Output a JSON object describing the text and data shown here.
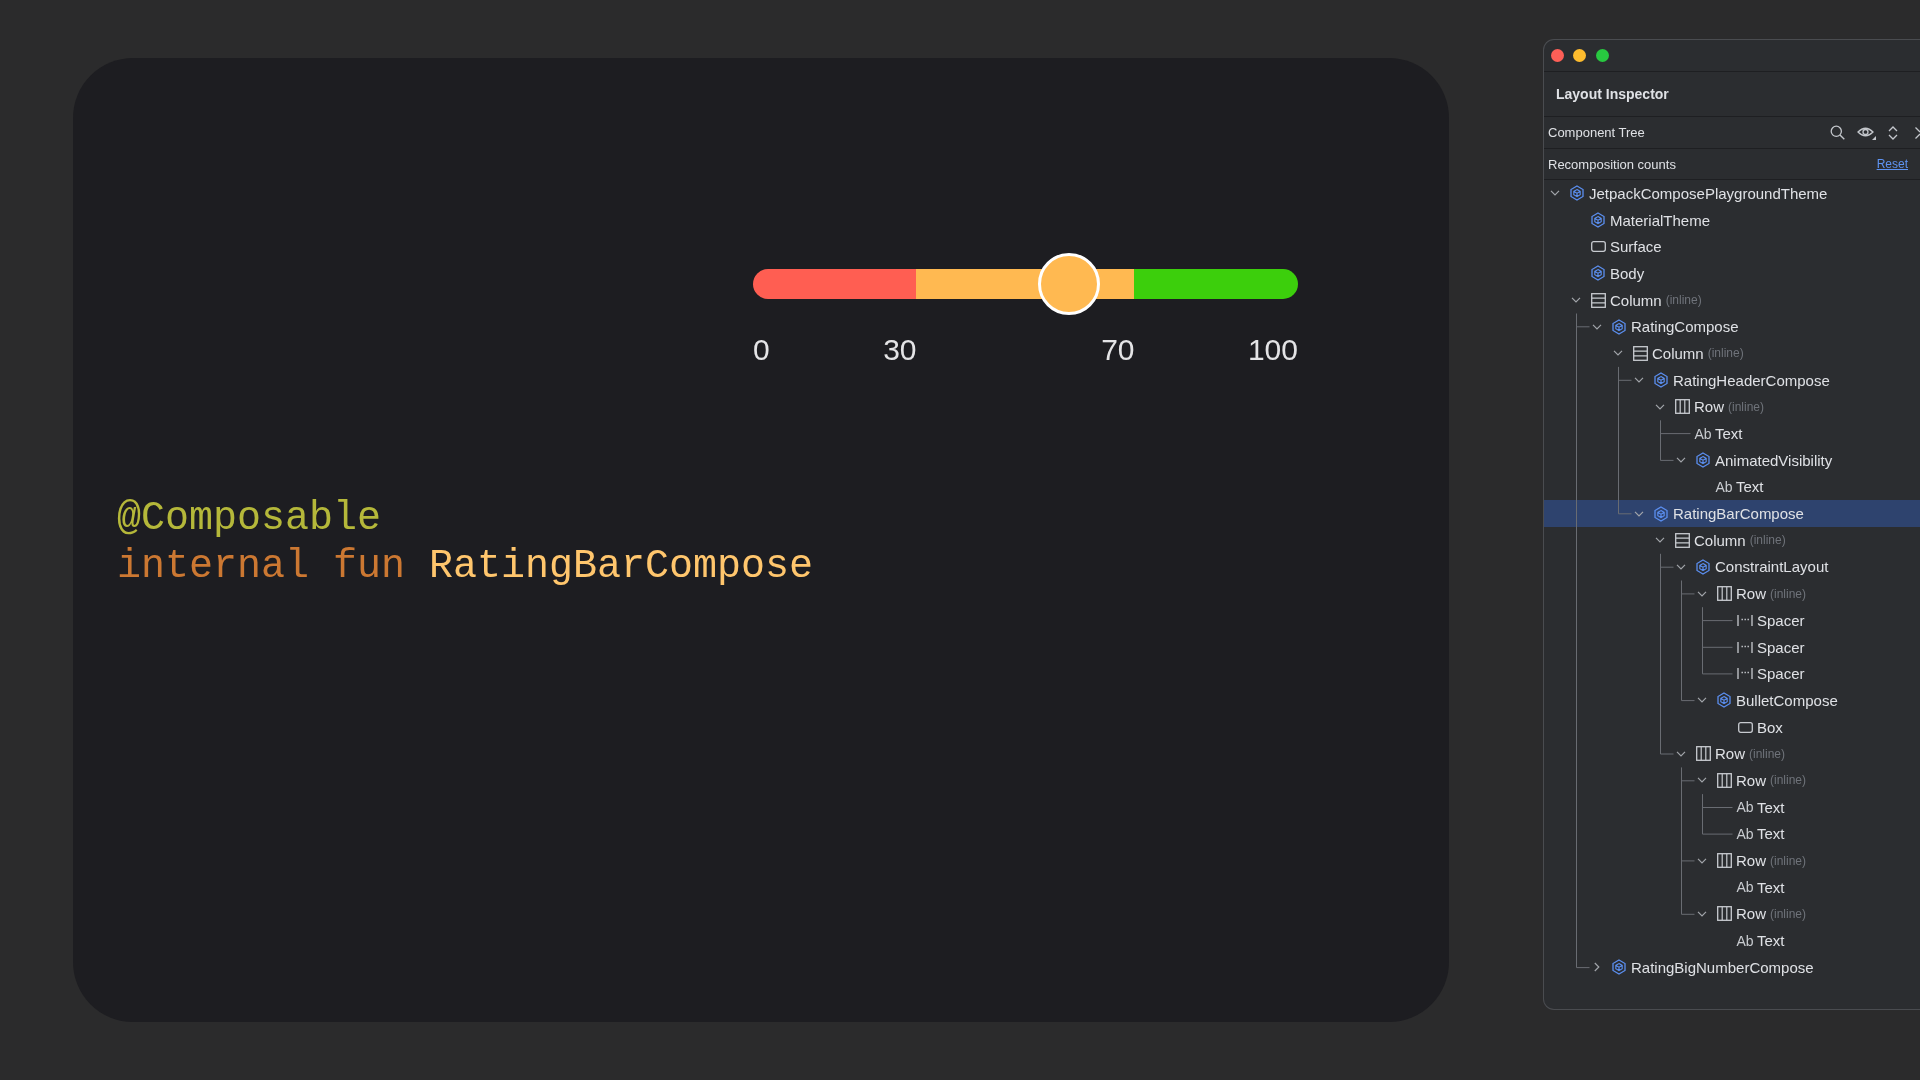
{
  "slider": {
    "level": 0.58,
    "segments": [
      {
        "color": "#ff5e52"
      },
      {
        "color": "#ffb951"
      },
      {
        "color": "#3ccf0c"
      }
    ],
    "marks": [
      "0",
      "30",
      "70",
      "100"
    ]
  },
  "code": [
    [
      {
        "kind": "annotation",
        "text": "@Composable"
      }
    ],
    [
      {
        "kind": "keyword",
        "text": "internal fun"
      },
      {
        "kind": "function",
        "text": "RatingBarCompose"
      }
    ]
  ],
  "inspector": {
    "title": "Layout Inspector",
    "section": "Component Tree",
    "option": "Recomposition counts",
    "reset": "Reset",
    "tree": [
      {
        "label": "JetpackComposePlaygroundTheme",
        "kind": "composable",
        "expanded": true,
        "selected": false,
        "children": [
          {
            "label": "MaterialTheme",
            "kind": "composable",
            "selected": false
          },
          {
            "label": "Surface",
            "kind": "box",
            "selected": false
          },
          {
            "label": "Body",
            "kind": "composable",
            "selected": false
          },
          {
            "label": "Column",
            "note": "(inline)",
            "kind": "column",
            "expanded": true,
            "selected": false,
            "children": [
              {
                "label": "RatingCompose",
                "kind": "composable",
                "expanded": true,
                "selected": false,
                "children": [
                  {
                    "label": "Column",
                    "note": "(inline)",
                    "kind": "column",
                    "expanded": true,
                    "selected": false,
                    "children": [
                      {
                        "label": "RatingHeaderCompose",
                        "kind": "composable",
                        "expanded": true,
                        "selected": false,
                        "children": [
                          {
                            "label": "Row",
                            "note": "(inline)",
                            "kind": "row",
                            "expanded": true,
                            "selected": false,
                            "children": [
                              {
                                "label": "Text",
                                "glyph": "Ab",
                                "kind": "text",
                                "selected": false
                              },
                              {
                                "label": "AnimatedVisibility",
                                "kind": "composable",
                                "expanded": true,
                                "selected": false,
                                "children": [
                                  {
                                    "label": "Text",
                                    "glyph": "Ab",
                                    "kind": "text",
                                    "selected": false
                                  }
                                ]
                              }
                            ]
                          }
                        ]
                      },
                      {
                        "label": "RatingBarCompose",
                        "kind": "composable",
                        "expanded": true,
                        "selected": true,
                        "children": [
                          {
                            "label": "Column",
                            "note": "(inline)",
                            "kind": "column",
                            "expanded": true,
                            "selected": false,
                            "children": [
                              {
                                "label": "ConstraintLayout",
                                "kind": "composable",
                                "expanded": true,
                                "selected": false,
                                "children": [
                                  {
                                    "label": "Row",
                                    "note": "(inline)",
                                    "kind": "row",
                                    "expanded": true,
                                    "selected": false,
                                    "children": [
                                      {
                                        "label": "Spacer",
                                        "kind": "spacer",
                                        "selected": false
                                      },
                                      {
                                        "label": "Spacer",
                                        "kind": "spacer",
                                        "selected": false
                                      },
                                      {
                                        "label": "Spacer",
                                        "kind": "spacer",
                                        "selected": false
                                      }
                                    ]
                                  },
                                  {
                                    "label": "BulletCompose",
                                    "kind": "composable",
                                    "expanded": true,
                                    "selected": false,
                                    "children": [
                                      {
                                        "label": "Box",
                                        "kind": "box",
                                        "selected": false
                                      }
                                    ]
                                  }
                                ]
                              },
                              {
                                "label": "Row",
                                "note": "(inline)",
                                "kind": "row",
                                "expanded": true,
                                "selected": false,
                                "children": [
                                  {
                                    "label": "Row",
                                    "note": "(inline)",
                                    "kind": "row",
                                    "expanded": true,
                                    "selected": false,
                                    "children": [
                                      {
                                        "label": "Text",
                                        "glyph": "Ab",
                                        "kind": "text",
                                        "selected": false
                                      },
                                      {
                                        "label": "Text",
                                        "glyph": "Ab",
                                        "kind": "text",
                                        "selected": false
                                      }
                                    ]
                                  },
                                  {
                                    "label": "Row",
                                    "note": "(inline)",
                                    "kind": "row",
                                    "expanded": true,
                                    "selected": false,
                                    "children": [
                                      {
                                        "label": "Text",
                                        "glyph": "Ab",
                                        "kind": "text",
                                        "selected": false
                                      }
                                    ]
                                  },
                                  {
                                    "label": "Row",
                                    "note": "(inline)",
                                    "kind": "row",
                                    "expanded": true,
                                    "selected": false,
                                    "children": [
                                      {
                                        "label": "Text",
                                        "glyph": "Ab",
                                        "kind": "text",
                                        "selected": false
                                      }
                                    ]
                                  }
                                ]
                              }
                            ]
                          }
                        ]
                      }
                    ]
                  }
                ]
              },
              {
                "label": "RatingBigNumberCompose",
                "kind": "composable",
                "expanded": false,
                "selected": false
              }
            ]
          }
        ]
      }
    ]
  }
}
